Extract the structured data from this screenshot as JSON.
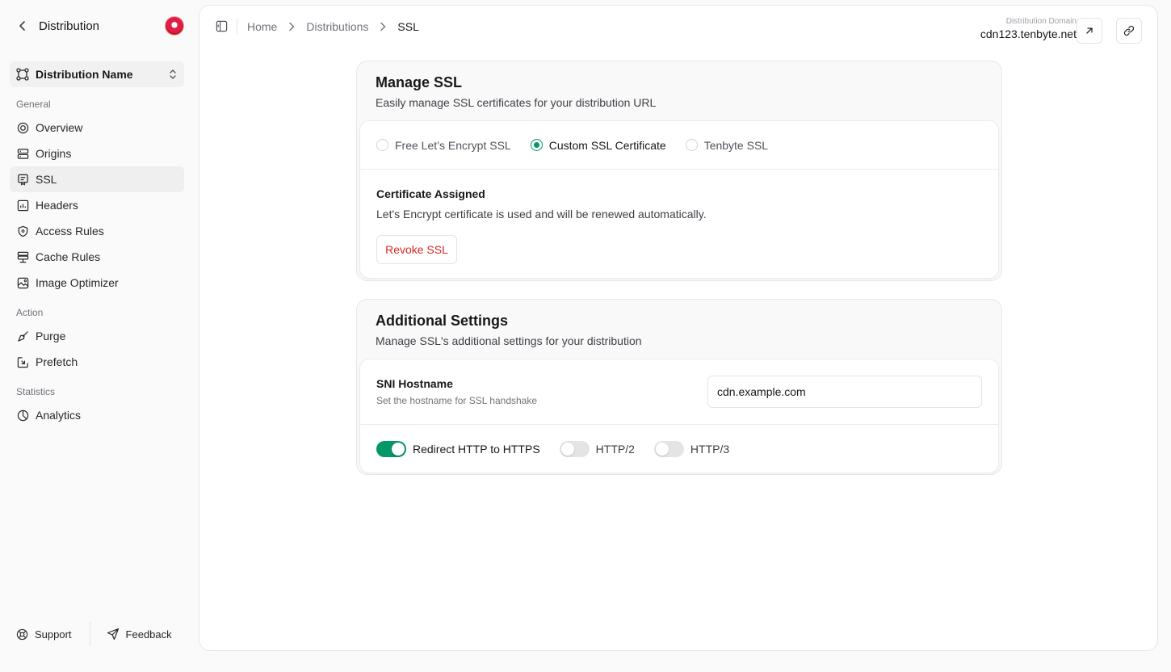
{
  "sidebar": {
    "title": "Distribution",
    "distribution_select": "Distribution Name",
    "groups": {
      "general": "General",
      "action": "Action",
      "statistics": "Statistics"
    },
    "items": {
      "overview": "Overview",
      "origins": "Origins",
      "ssl": "SSL",
      "headers": "Headers",
      "access_rules": "Access Rules",
      "cache_rules": "Cache Rules",
      "image_optimizer": "Image Optimizer",
      "purge": "Purge",
      "prefetch": "Prefetch",
      "analytics": "Analytics"
    },
    "active_item": "SSL",
    "footer": {
      "support": "Support",
      "feedback": "Feedback"
    }
  },
  "header": {
    "breadcrumbs": [
      "Home",
      "Distributions",
      "SSL"
    ],
    "domain_caption": "Distribution Domain",
    "domain_value": "cdn123.tenbyte.net"
  },
  "manage_ssl": {
    "title": "Manage SSL",
    "subtitle": "Easily manage SSL certificates for your distribution URL",
    "options": [
      "Free Let’s Encrypt SSL",
      "Custom SSL Certificate",
      "Tenbyte SSL"
    ],
    "selected_option": "Custom SSL Certificate",
    "certificate_title": "Certificate Assigned",
    "certificate_desc": "Let's Encrypt certificate is used and will be renewed automatically.",
    "revoke_label": "Revoke SSL"
  },
  "additional": {
    "title": "Additional Settings",
    "subtitle": "Manage SSL's additional settings for your distribution",
    "sni_title": "SNI Hostname",
    "sni_desc": "Set the hostname for SSL handshake",
    "sni_value": "cdn.example.com",
    "toggles": {
      "redirect": {
        "label": "Redirect HTTP to HTTPS",
        "on": true
      },
      "http2": {
        "label": "HTTP/2",
        "on": false
      },
      "http3": {
        "label": "HTTP/3",
        "on": false
      }
    }
  },
  "colors": {
    "accent": "#059669",
    "danger": "#dc2626",
    "sidebar_bg": "#fafafa",
    "active_item_bg": "#efefef"
  }
}
